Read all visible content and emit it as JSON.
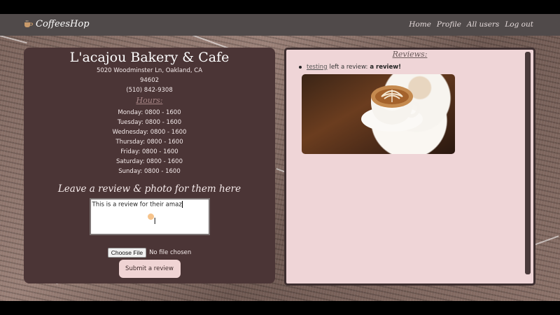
{
  "brand": {
    "name": "CoffeesHop",
    "icon": "coffee-cup-icon"
  },
  "nav": [
    "Home",
    "Profile",
    "All users",
    "Log out"
  ],
  "shop": {
    "name": "L'acajou Bakery & Cafe",
    "address_line1": "5020 Woodminster Ln, Oakland, CA",
    "address_line2": "94602",
    "phone": "(510) 842-9308",
    "hours_title": "Hours:",
    "hours": [
      "Monday: 0800 - 1600",
      "Tuesday: 0800 - 1600",
      "Wednesday: 0800 - 1600",
      "Thursday: 0800 - 1600",
      "Friday: 0800 - 1600",
      "Saturday: 0800 - 1600",
      "Sunday: 0800 - 1600"
    ]
  },
  "review_form": {
    "prompt": "Leave a review & photo for them here",
    "text_value": "This is a review for their amaz",
    "choose_file_label": "Choose File",
    "file_status": "No file chosen",
    "submit_label": "Submit a review"
  },
  "reviews": {
    "title": "Reviews:",
    "items": [
      {
        "user": "testing",
        "middle": "left a review:",
        "text": "a review!"
      }
    ]
  },
  "colors": {
    "navbar": "#504a4a",
    "left_card": "#4b3536",
    "reviews_card": "#efd5d7",
    "submit_button": "#f0d4d4"
  }
}
